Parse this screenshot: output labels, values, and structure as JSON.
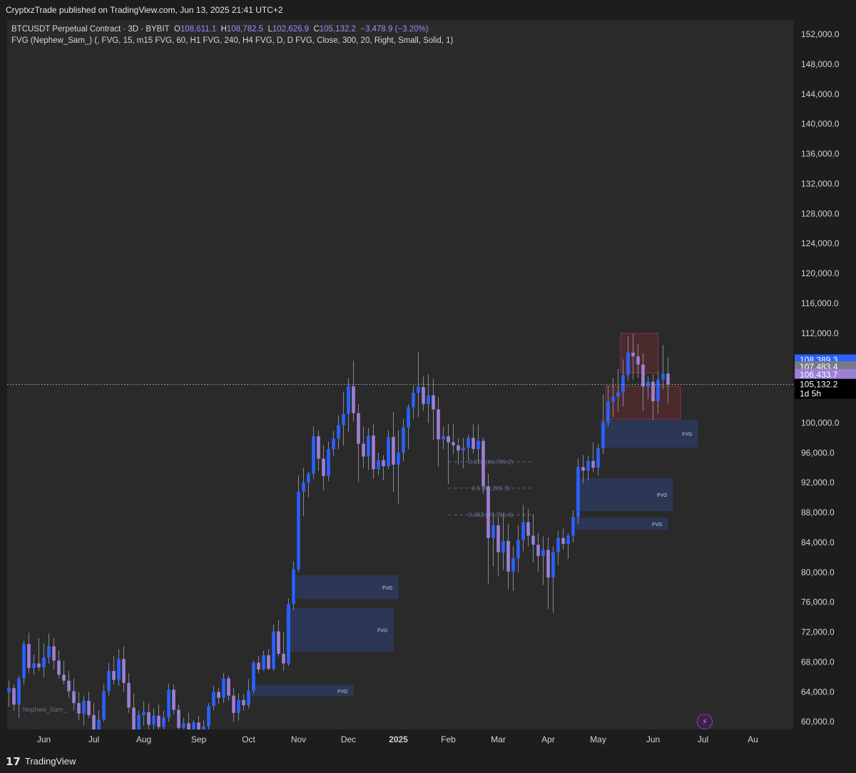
{
  "header": {
    "published_text": "CryptxzTrade published on TradingView.com, Jun 13, 2025 21:41 UTC+2"
  },
  "legend": {
    "symbol": "BTCUSDT Perpetual Contract · 3D · BYBIT",
    "o_label": "O",
    "o_value": "108,611.1",
    "h_label": "H",
    "h_value": "108,782.5",
    "l_label": "L",
    "l_value": "102,626.9",
    "c_label": "C",
    "c_value": "105,132.2",
    "change": "−3,478.9 (−3.20%)",
    "indicator": "FVG (Nephew_Sam_) (, FVG, 15, m15 FVG, 60, H1 FVG, 240, H4 FVG, D, D FVG, Close, 300, 20, Right, Small, Solid, 1)"
  },
  "price_tags": [
    {
      "text": "108,389.3",
      "price": 108389.3,
      "bg": "#2962ff"
    },
    {
      "text": "107,483.4",
      "price": 107483.4,
      "bg": "#787b86"
    },
    {
      "text": "106,433.7",
      "price": 106433.7,
      "bg": "#9c7fd6"
    },
    {
      "text": "105,132.2",
      "price": 105132.2,
      "bg": "#000000",
      "sub": "1d 5h"
    }
  ],
  "watermark": "Nephew_Sam_",
  "footer": {
    "brand": "TradingView",
    "logo": "17"
  },
  "colors": {
    "up": "#2962ff",
    "down": "#9c7fd6",
    "fvg_bull": "#2c3a5c",
    "fvg_bear": "#5a2b31"
  },
  "chart_data": {
    "type": "candlestick",
    "ylim": [
      60000,
      153000
    ],
    "y_ticks": [
      60000,
      64000,
      68000,
      72000,
      76000,
      80000,
      84000,
      88000,
      92000,
      96000,
      100000,
      104000,
      108000,
      112000,
      116000,
      120000,
      124000,
      128000,
      132000,
      136000,
      140000,
      144000,
      148000,
      152000
    ],
    "y_tick_labels": [
      "60,000.0",
      "64,000.0",
      "68,000.0",
      "72,000.0",
      "76,000.0",
      "80,000.0",
      "84,000.0",
      "88,000.0",
      "92,000.0",
      "96,000.0",
      "100,000.0",
      "104,000.0",
      "108,000.0",
      "112,000.0",
      "116,000.0",
      "120,000.0",
      "124,000.0",
      "128,000.0",
      "132,000.0",
      "136,000.0",
      "140,000.0",
      "144,000.0",
      "148,000.0",
      "152,000.0"
    ],
    "x_labels": [
      {
        "text": "Jun",
        "i": 7,
        "bold": false
      },
      {
        "text": "Jul",
        "i": 17,
        "bold": false
      },
      {
        "text": "Aug",
        "i": 27,
        "bold": false
      },
      {
        "text": "Sep",
        "i": 38,
        "bold": false
      },
      {
        "text": "Oct",
        "i": 48,
        "bold": false
      },
      {
        "text": "Nov",
        "i": 58,
        "bold": false
      },
      {
        "text": "Dec",
        "i": 68,
        "bold": false
      },
      {
        "text": "2025",
        "i": 78,
        "bold": true
      },
      {
        "text": "Feb",
        "i": 88,
        "bold": false
      },
      {
        "text": "Mar",
        "i": 98,
        "bold": false
      },
      {
        "text": "Apr",
        "i": 108,
        "bold": false
      },
      {
        "text": "May",
        "i": 118,
        "bold": false
      },
      {
        "text": "Jun",
        "i": 129,
        "bold": false
      },
      {
        "text": "Jul",
        "i": 139,
        "bold": false
      },
      {
        "text": "Au",
        "i": 149,
        "bold": false
      }
    ],
    "ohlc": [
      [
        64000,
        65500,
        62000,
        64500
      ],
      [
        64500,
        65000,
        61500,
        62300
      ],
      [
        62300,
        66200,
        60500,
        65800
      ],
      [
        65800,
        70800,
        65000,
        70400
      ],
      [
        70400,
        71900,
        66500,
        67200
      ],
      [
        67200,
        69000,
        66300,
        67800
      ],
      [
        67800,
        71200,
        66800,
        67300
      ],
      [
        67300,
        70500,
        66000,
        68600
      ],
      [
        68600,
        71800,
        67800,
        70100
      ],
      [
        70100,
        71200,
        67000,
        68200
      ],
      [
        68200,
        69500,
        65800,
        66300
      ],
      [
        66300,
        68200,
        65000,
        65500
      ],
      [
        65500,
        66800,
        63200,
        64100
      ],
      [
        64100,
        65800,
        61500,
        62500
      ],
      [
        62500,
        64000,
        60200,
        61100
      ],
      [
        61100,
        63500,
        59500,
        62800
      ],
      [
        62800,
        64000,
        60500,
        60900
      ],
      [
        60900,
        62500,
        56500,
        58200
      ],
      [
        58200,
        61500,
        55800,
        60300
      ],
      [
        60300,
        65000,
        60000,
        64100
      ],
      [
        64100,
        67900,
        63500,
        66800
      ],
      [
        66800,
        68800,
        65000,
        65600
      ],
      [
        65600,
        69700,
        64800,
        68400
      ],
      [
        68400,
        70100,
        64000,
        65200
      ],
      [
        65200,
        66500,
        61200,
        61900
      ],
      [
        61900,
        63800,
        58000,
        58600
      ],
      [
        58600,
        61500,
        49000,
        60900
      ],
      [
        60900,
        62800,
        59500,
        61300
      ],
      [
        61300,
        62500,
        58200,
        59600
      ],
      [
        59600,
        61800,
        57200,
        60800
      ],
      [
        60800,
        62300,
        58500,
        59300
      ],
      [
        59300,
        61500,
        58000,
        60600
      ],
      [
        60600,
        65100,
        60000,
        64300
      ],
      [
        64300,
        65000,
        61000,
        61600
      ],
      [
        61600,
        62300,
        58800,
        59200
      ],
      [
        59200,
        60500,
        57500,
        59800
      ],
      [
        59800,
        61200,
        57600,
        58300
      ],
      [
        58300,
        60200,
        57800,
        59900
      ],
      [
        59900,
        60800,
        56800,
        57500
      ],
      [
        57500,
        60200,
        54000,
        59400
      ],
      [
        59400,
        62500,
        58800,
        62100
      ],
      [
        62100,
        64800,
        61500,
        64000
      ],
      [
        64000,
        64600,
        62300,
        63200
      ],
      [
        63200,
        66500,
        62500,
        65800
      ],
      [
        65800,
        66200,
        62800,
        63500
      ],
      [
        63500,
        64500,
        60000,
        61200
      ],
      [
        61200,
        63800,
        60200,
        62900
      ],
      [
        62900,
        63700,
        61500,
        62200
      ],
      [
        62200,
        65700,
        61800,
        64200
      ],
      [
        64200,
        68200,
        63800,
        67900
      ],
      [
        67900,
        68800,
        66500,
        67000
      ],
      [
        67000,
        69500,
        66800,
        68900
      ],
      [
        68900,
        69700,
        66900,
        67100
      ],
      [
        67100,
        73000,
        66800,
        72100
      ],
      [
        72100,
        73600,
        68700,
        69100
      ],
      [
        69100,
        72000,
        66800,
        67800
      ],
      [
        67800,
        76500,
        67500,
        75800
      ],
      [
        75800,
        81500,
        75000,
        80400
      ],
      [
        80400,
        93000,
        80000,
        90800
      ],
      [
        90800,
        94000,
        87500,
        92000
      ],
      [
        92000,
        93500,
        90000,
        93200
      ],
      [
        93200,
        99500,
        92500,
        98200
      ],
      [
        98200,
        99000,
        93600,
        95200
      ],
      [
        95200,
        97000,
        91000,
        92900
      ],
      [
        92900,
        97500,
        92200,
        96500
      ],
      [
        96500,
        98900,
        95500,
        97900
      ],
      [
        97900,
        101000,
        96500,
        99700
      ],
      [
        99700,
        104100,
        97000,
        101200
      ],
      [
        101200,
        106000,
        98800,
        104900
      ],
      [
        104900,
        108300,
        100200,
        101300
      ],
      [
        101300,
        102500,
        92100,
        97200
      ],
      [
        97200,
        99500,
        94000,
        95500
      ],
      [
        95500,
        99300,
        93700,
        98300
      ],
      [
        98300,
        99800,
        92500,
        93800
      ],
      [
        93800,
        96000,
        93000,
        95000
      ],
      [
        95000,
        95700,
        92300,
        94200
      ],
      [
        94200,
        99000,
        93800,
        98100
      ],
      [
        98100,
        101500,
        90800,
        94400
      ],
      [
        94400,
        99000,
        89200,
        96000
      ],
      [
        96000,
        100500,
        94900,
        99400
      ],
      [
        99400,
        102500,
        96500,
        102100
      ],
      [
        102100,
        105000,
        100500,
        104000
      ],
      [
        104000,
        109500,
        100800,
        104800
      ],
      [
        104800,
        106200,
        101600,
        102500
      ],
      [
        102500,
        106500,
        100000,
        103700
      ],
      [
        103700,
        105900,
        97700,
        101800
      ],
      [
        101800,
        103500,
        94200,
        97800
      ],
      [
        97800,
        99500,
        96500,
        98200
      ],
      [
        98200,
        99900,
        91800,
        97400
      ],
      [
        97400,
        99800,
        95800,
        97000
      ],
      [
        97000,
        98000,
        94400,
        96300
      ],
      [
        96300,
        98000,
        93900,
        96700
      ],
      [
        96700,
        98400,
        95000,
        98000
      ],
      [
        98000,
        99800,
        95900,
        96500
      ],
      [
        96500,
        99800,
        94800,
        97600
      ],
      [
        97600,
        98000,
        90500,
        91500
      ],
      [
        91500,
        93200,
        78500,
        84600
      ],
      [
        84600,
        87800,
        80800,
        86300
      ],
      [
        86300,
        87500,
        79500,
        82700
      ],
      [
        82700,
        87900,
        80300,
        84200
      ],
      [
        84200,
        86500,
        77800,
        80100
      ],
      [
        80100,
        83500,
        77500,
        81900
      ],
      [
        81900,
        86300,
        80000,
        84300
      ],
      [
        84300,
        89000,
        82800,
        86700
      ],
      [
        86700,
        88500,
        83500,
        84900
      ],
      [
        84900,
        87800,
        81300,
        83700
      ],
      [
        83700,
        85300,
        80100,
        82200
      ],
      [
        82200,
        84800,
        78300,
        83000
      ],
      [
        83000,
        84700,
        75100,
        79300
      ],
      [
        79300,
        83500,
        74600,
        82700
      ],
      [
        82700,
        85500,
        81000,
        84600
      ],
      [
        84600,
        85900,
        83000,
        83800
      ],
      [
        83800,
        85200,
        81800,
        84900
      ],
      [
        84900,
        88300,
        84000,
        87400
      ],
      [
        87400,
        95200,
        86500,
        94100
      ],
      [
        94100,
        95700,
        91900,
        93600
      ],
      [
        93600,
        95600,
        92300,
        94900
      ],
      [
        94900,
        97400,
        93400,
        94000
      ],
      [
        94000,
        97200,
        92900,
        96600
      ],
      [
        96600,
        103800,
        95800,
        100000
      ],
      [
        100000,
        105000,
        99500,
        102800
      ],
      [
        102800,
        106000,
        100800,
        103500
      ],
      [
        103500,
        107200,
        101500,
        104100
      ],
      [
        104100,
        108500,
        102200,
        106400
      ],
      [
        106400,
        111600,
        105600,
        109400
      ],
      [
        109400,
        111900,
        105800,
        108900
      ],
      [
        108900,
        110500,
        106000,
        107800
      ],
      [
        107800,
        109300,
        101600,
        104900
      ],
      [
        104900,
        106200,
        103200,
        105500
      ],
      [
        105500,
        106500,
        100400,
        102900
      ],
      [
        102900,
        106800,
        101200,
        105800
      ],
      [
        105800,
        110400,
        104500,
        106600
      ],
      [
        106600,
        108800,
        102600,
        105132
      ]
    ],
    "fvg_zones": [
      {
        "kind": "bull",
        "label": "FVG",
        "i0": 57.5,
        "i1": 78,
        "p_top": 79600,
        "p_bot": 76400
      },
      {
        "kind": "bull",
        "label": "FVG",
        "i0": 55.5,
        "i1": 77,
        "p_top": 75200,
        "p_bot": 69400
      },
      {
        "kind": "bull",
        "label": "FVG",
        "i0": 48.5,
        "i1": 69,
        "p_top": 64900,
        "p_bot": 63400
      },
      {
        "kind": "bull",
        "label": "FVG",
        "i0": 113.5,
        "i1": 133,
        "p_top": 92600,
        "p_bot": 88200
      },
      {
        "kind": "bull",
        "label": "FVG",
        "i0": 113.5,
        "i1": 132,
        "p_top": 87300,
        "p_bot": 85700
      },
      {
        "kind": "bull",
        "label": "FVG",
        "i0": 118.5,
        "i1": 138,
        "p_top": 100400,
        "p_bot": 96700
      },
      {
        "kind": "bear",
        "label": "",
        "i0": 119.5,
        "i1": 134.5,
        "p_top": 104900,
        "p_bot": 100500
      },
      {
        "kind": "bear",
        "label": "",
        "i0": 122.5,
        "i1": 130,
        "p_top": 112000,
        "p_bot": 106700
      }
    ],
    "fib_levels": [
      {
        "label": "0.618 (94,789.2)",
        "price": 94789.2,
        "i0": 88,
        "i1": 105
      },
      {
        "label": "0.5 (91,265.3)",
        "price": 91265.3,
        "i0": 88,
        "i1": 105
      },
      {
        "label": "0.382 (87,701.4)",
        "price": 87701.4,
        "i0": 88,
        "i1": 105
      }
    ],
    "current_price": 105132.2
  }
}
